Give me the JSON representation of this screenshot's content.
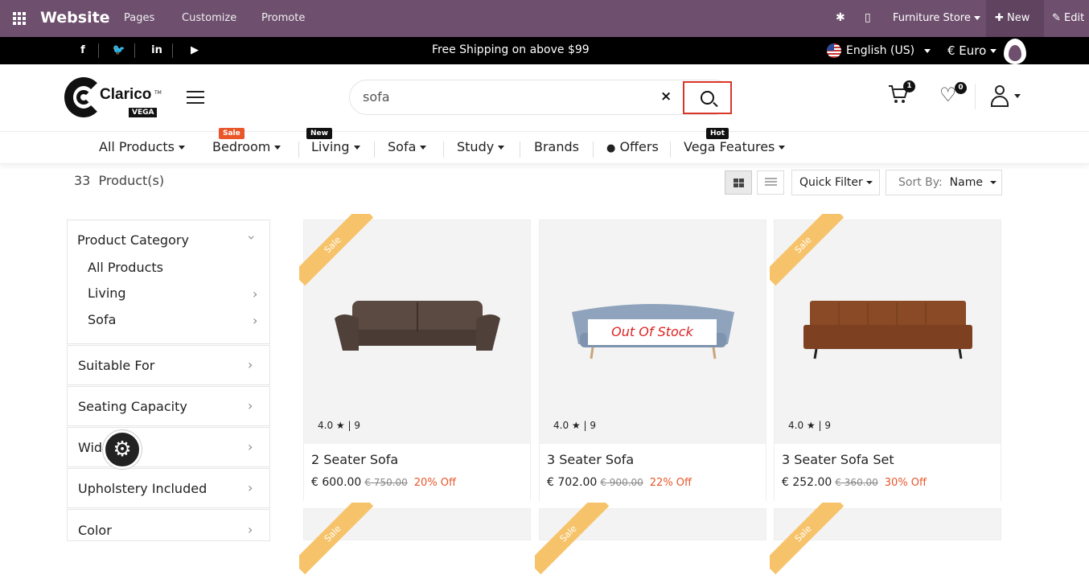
{
  "topbar": {
    "brand": "Website",
    "nav": [
      "Pages",
      "Customize",
      "Promote"
    ],
    "store": "Furniture Store",
    "new_label": "New",
    "edit_label": "Edit"
  },
  "promo": {
    "social": [
      "f",
      "t",
      "in",
      "yt"
    ],
    "shipping": "Free Shipping on above $99",
    "language": "English (US)",
    "currency": "€ Euro"
  },
  "header": {
    "logo_text": "Clarico",
    "logo_sub": "VEGA",
    "logo_tm": "TM",
    "search_value": "sofa",
    "cart_count": "1",
    "wishlist_count": "0"
  },
  "menu": {
    "items": [
      "All Products",
      "Bedroom",
      "Living",
      "Sofa",
      "Study",
      "Brands",
      "Offers",
      "Vega Features"
    ],
    "tags": {
      "bedroom": "Sale",
      "living": "New",
      "vega": "Hot"
    }
  },
  "toolbar": {
    "count": "33",
    "count_suffix": "Product(s)",
    "quick_filter": "Quick Filter",
    "sort_label": "Sort By:",
    "sort_value": "Name"
  },
  "sidebar": {
    "category_title": "Product Category",
    "categories": [
      "All Products",
      "Living",
      "Sofa"
    ],
    "filters": [
      "Suitable For",
      "Seating Capacity",
      "Wid",
      "Upholstery Included",
      "Color"
    ]
  },
  "products": [
    {
      "name": "2 Seater Sofa",
      "price": "€ 600.00",
      "old": "€ 750.00",
      "off": "20% Off",
      "rating": "4.0",
      "reviews": "9",
      "ribbon": "Sale",
      "sofa_color": "#5a4a42"
    },
    {
      "name": "3 Seater Sofa",
      "price": "€ 702.00",
      "old": "€ 900.00",
      "off": "22% Off",
      "rating": "4.0",
      "reviews": "9",
      "status": "Out Of Stock",
      "sofa_color": "#8fa3bd"
    },
    {
      "name": "3 Seater Sofa Set",
      "price": "€ 252.00",
      "old": "€ 360.00",
      "off": "30% Off",
      "rating": "4.0",
      "reviews": "9",
      "ribbon": "Sale",
      "sofa_color": "#8a4a25"
    }
  ],
  "colors": {
    "topbar": "#6e4f6e",
    "accent": "#e8562a",
    "ribbon": "#f6c36a",
    "search_border": "#d9372a"
  }
}
